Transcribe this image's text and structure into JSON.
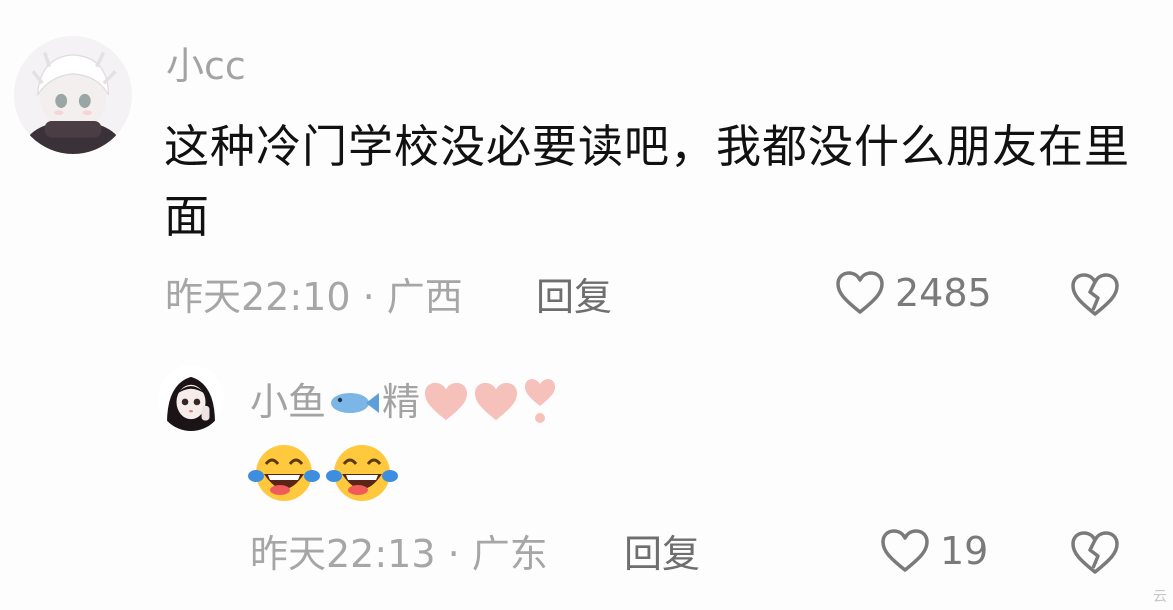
{
  "comments": [
    {
      "username": "小cc",
      "text": "这种冷门学校没必要读吧，我都没什么朋友在里面",
      "meta": "昨天22:10 · 广西",
      "reply_label": "回复",
      "like_count": "2485"
    },
    {
      "username_prefix": "小鱼",
      "username_suffix": "精",
      "emojis": [
        "face-with-tears-of-joy",
        "face-with-tears-of-joy"
      ],
      "meta": "昨天22:13 · 广东",
      "reply_label": "回复",
      "like_count": "19"
    }
  ],
  "icons": {
    "like": "heart-outline-icon",
    "dislike": "broken-heart-icon",
    "fish": "fish-emoji",
    "pink_heart": "pink-heart-emoji",
    "exclamation": "heart-exclamation-emoji"
  },
  "colors": {
    "username": "#a3a3a3",
    "text": "#111111",
    "meta": "#a6a6a6",
    "reply": "#6e6e6e",
    "pink": "#f7c1bb"
  },
  "watermark": "云"
}
